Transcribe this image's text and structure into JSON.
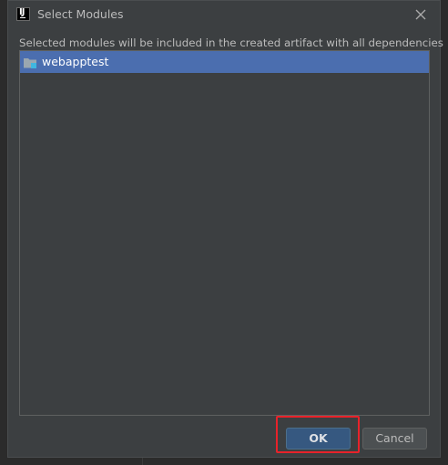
{
  "window": {
    "title": "Select Modules",
    "app_icon_glyph": "IJ"
  },
  "description": "Selected modules will be included in the created artifact with all dependencies",
  "modules": [
    {
      "label": "webapptest",
      "selected": true,
      "icon": "module-folder-icon"
    }
  ],
  "buttons": {
    "ok_label": "OK",
    "cancel_label": "Cancel"
  },
  "colors": {
    "dialog_bg": "#3c3f41",
    "selection": "#4b6eaf",
    "ok_button": "#365880",
    "highlight": "#e8222a"
  }
}
